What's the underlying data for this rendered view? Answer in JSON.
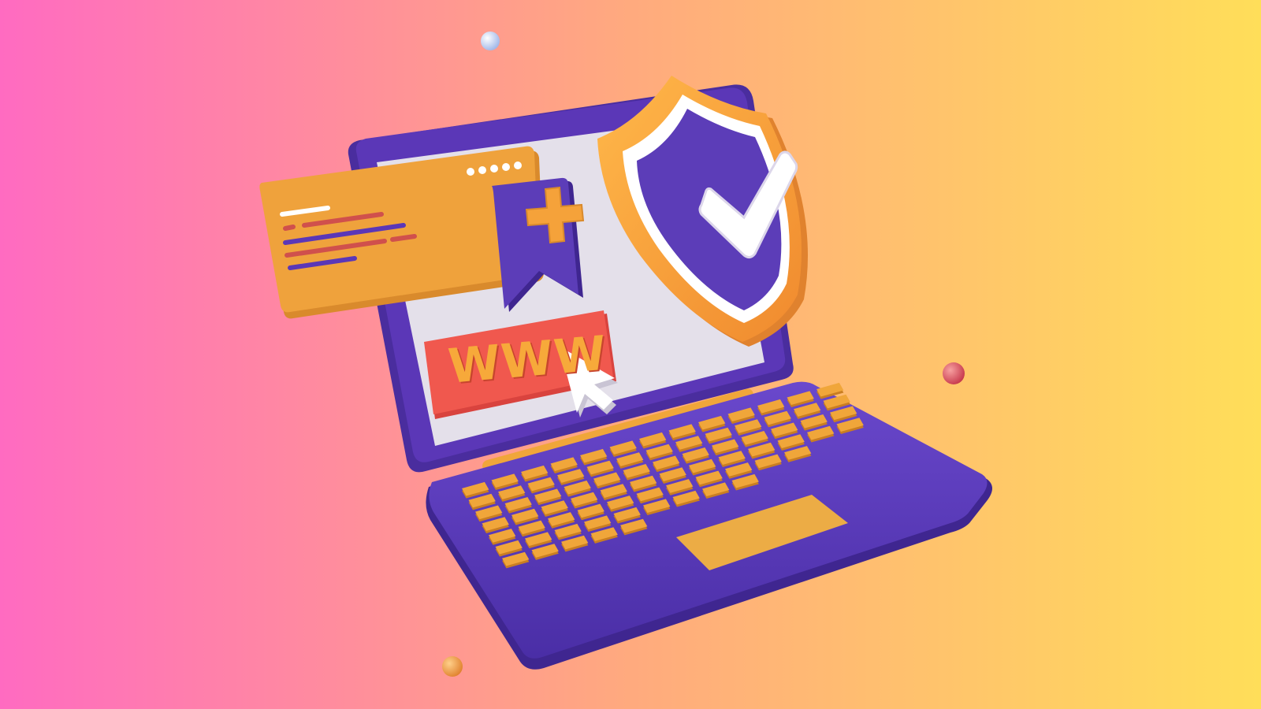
{
  "colors": {
    "background_left": "#FF6BC1",
    "background_mid": "#FFAA7E",
    "background_right": "#FFDE59",
    "laptop": "#5B37B7",
    "laptop_dark": "#3F2690",
    "screen": "#E4E0EA",
    "keys": "#F0A63A",
    "shield_outer": "#F5A23A",
    "shield_white": "#FFFFFF",
    "shield_inner": "#5C3DB8",
    "card": "#EFA23C",
    "url_bar": "#F0584E",
    "text_line_red": "#D0504C",
    "text_line_purple": "#5B37B7"
  },
  "icons": [
    "shield-check-icon",
    "bookmark-plus-icon",
    "cursor-arrow-icon"
  ],
  "screen": {
    "url_bar_text": "WWW"
  }
}
